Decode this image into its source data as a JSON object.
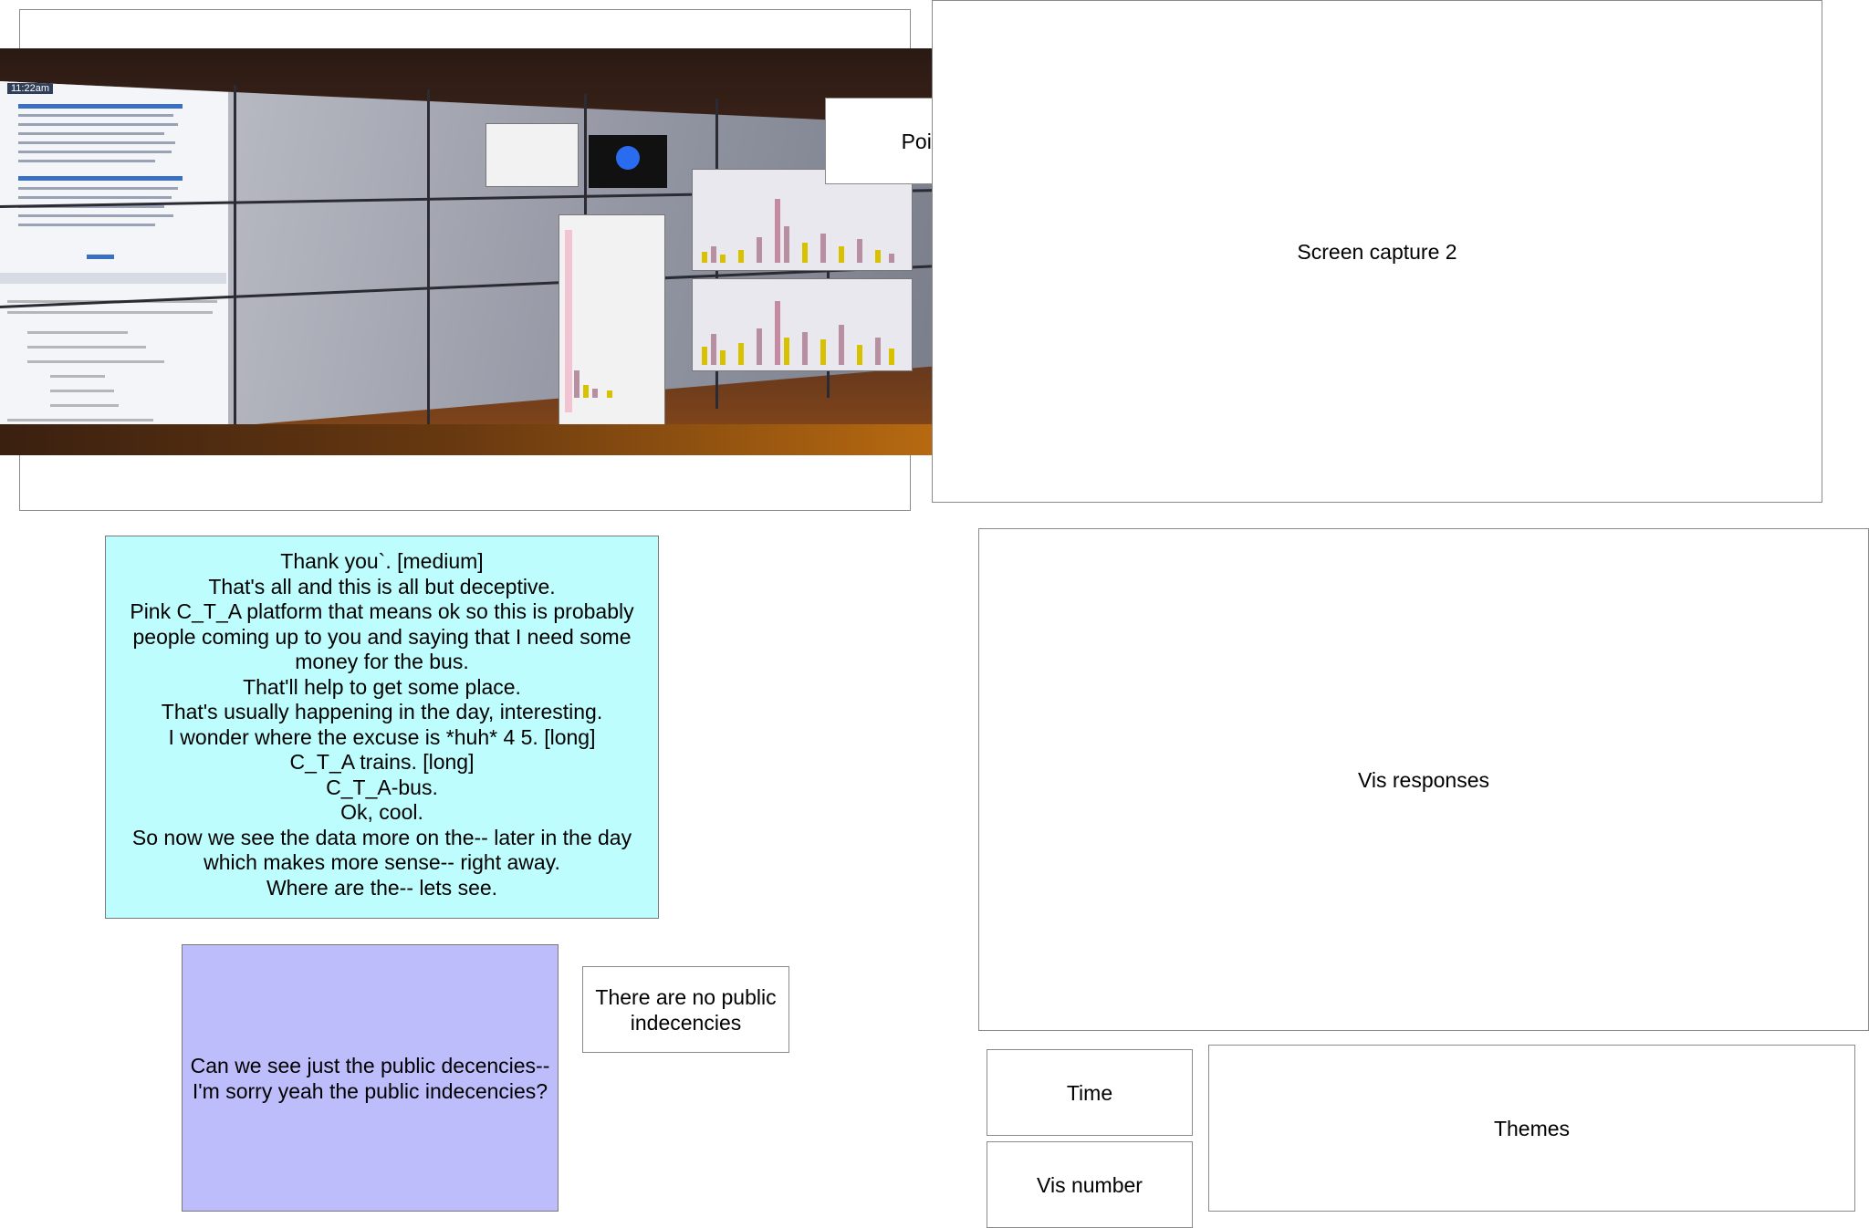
{
  "screen_capture_1": {
    "photo_alt": "Photo of a large tiled display wall showing documents and bar charts",
    "clock": "11:22am"
  },
  "point_label": "Point!",
  "screen_capture_2_label": "Screen capture 2",
  "transcript": {
    "lines": [
      "Thank you`. [medium]",
      "That's all and this is all but deceptive.",
      "Pink C_T_A platform that means ok so this is probably people coming up to you and saying that I need some money for the bus.",
      "That'll help to get some place.",
      "That's usually happening in the day, interesting.",
      "I wonder where the excuse is *huh* 4 5. [long]",
      "C_T_A trains. [long]",
      "C_T_A-bus.",
      "Ok, cool.",
      "So now we see the data more on the-- later in the day which makes more sense-- right away.",
      "Where are the-- lets see."
    ]
  },
  "question_text": "Can we see just the public decencies-- I'm sorry yeah the public indecencies?",
  "answer_text": "There are no public indecencies",
  "vis_responses_label": "Vis responses",
  "time_label": "Time",
  "vis_number_label": "Vis number",
  "themes_label": "Themes"
}
